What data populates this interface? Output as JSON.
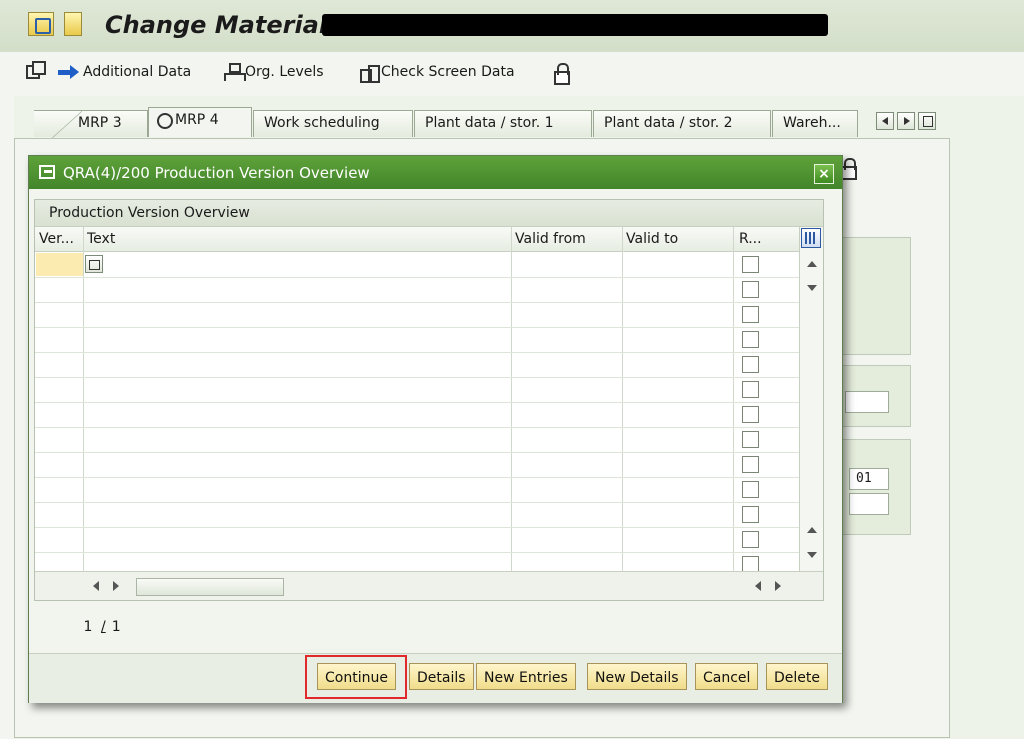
{
  "window": {
    "title": "Change Material"
  },
  "toolbar": {
    "additional_data": "Additional Data",
    "org_levels": "Org. Levels",
    "check_screen_data": "Check Screen Data"
  },
  "tabs": [
    {
      "label": "MRP 3"
    },
    {
      "label": "MRP 4"
    },
    {
      "label": "Work scheduling"
    },
    {
      "label": "Plant data / stor. 1"
    },
    {
      "label": "Plant data / stor. 2"
    },
    {
      "label": "Wareh..."
    }
  ],
  "background": {
    "field_value": "01"
  },
  "dialog": {
    "title": "QRA(4)/200 Production Version Overview",
    "caption": "Production Version Overview",
    "columns": [
      "Ver...",
      "Text",
      "Valid from",
      "Valid to",
      "R..."
    ],
    "rows_count_visible": 13,
    "page_current": "1",
    "page_separator": "/",
    "page_total": "1",
    "buttons": {
      "continue": "Continue",
      "details": "Details",
      "new_entries": "New Entries",
      "new_details": "New Details",
      "cancel": "Cancel",
      "delete": "Delete"
    }
  },
  "colors": {
    "dialog_title_bg": "#4f9632",
    "button_bg": "#f6e6a6",
    "highlight_border": "#e0282d",
    "selected_cell": "#fcebb0"
  }
}
